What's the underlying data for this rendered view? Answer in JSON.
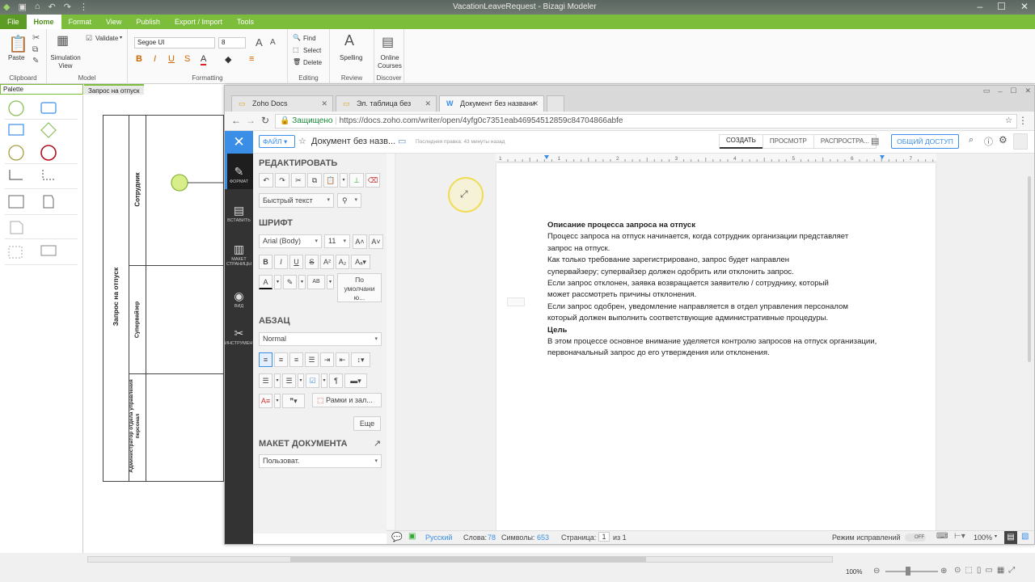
{
  "app": {
    "title": "VacationLeaveRequest - Bizagi Modeler",
    "tabs": [
      "File",
      "Home",
      "Format",
      "View",
      "Publish",
      "Export / Import",
      "Tools"
    ],
    "ribbon": {
      "clipboard": {
        "paste": "Paste",
        "label": "Clipboard"
      },
      "model": {
        "sim_line1": "Simulation",
        "sim_line2": "View",
        "validate": "Validate",
        "label": "Model"
      },
      "formatting": {
        "font": "Segoe UI",
        "size": "8",
        "label": "Formatting"
      },
      "editing": {
        "find": "Find",
        "select": "Select",
        "delete": "Delete",
        "label": "Editing"
      },
      "review": {
        "spelling": "Spelling",
        "label": "Review"
      },
      "discover": {
        "line1": "Online",
        "line2": "Courses",
        "label": "Discover"
      }
    },
    "palette_label": "Palette",
    "diagram_tab": "Запрос на отпуск",
    "pool_label": "Запрос на отпуск",
    "lanes": [
      "Сотрудник",
      "Супервайзер",
      "Администратор отдела управления персонал"
    ],
    "zoom": "100%"
  },
  "browser": {
    "tabs": [
      {
        "label": "Zoho Docs",
        "icon": "folder-icon"
      },
      {
        "label": "Эл. таблица без назван",
        "icon": "folder-icon"
      },
      {
        "label": "Документ без названи",
        "icon": "zoho-writer-icon"
      }
    ],
    "secure_label": "Защищено",
    "url": "https://docs.zoho.com/writer/open/4yfg0c7351eab46954512859c84704866abfe"
  },
  "writer": {
    "file_button": "ФАЙЛ",
    "doc_title": "Документ без назв...",
    "last_edit": "Последняя правка: 43 минуты назад",
    "modes": [
      "СОЗДАТЬ",
      "ПРОСМОТР",
      "РАСПРОСТРА..."
    ],
    "share_button": "ОБЩИЙ ДОСТУП",
    "rail": [
      {
        "icon": "pen-icon",
        "label": "ФОРМАТ"
      },
      {
        "icon": "insert-icon",
        "label": "ВСТАВИТЬ"
      },
      {
        "icon": "page-layout-icon",
        "label": "МАКЕТ СТРАНИЦЫ"
      },
      {
        "icon": "eye-icon",
        "label": "ВИД"
      },
      {
        "icon": "tools-icon",
        "label": "ИНСТРУМЕНТЫ"
      }
    ],
    "panel": {
      "edit_heading": "РЕДАКТИРОВАТЬ",
      "quick_text": "Быстрый текст",
      "font_heading": "ШРИФТ",
      "font_name": "Arial (Body)",
      "font_size": "11",
      "default_line1": "По",
      "default_line2": "умолчани",
      "default_line3": "ю...",
      "para_heading": "АБЗАЦ",
      "para_style": "Normal",
      "borders": "Рамки и зал...",
      "more": "Еще",
      "layout_heading": "МАКЕТ ДОКУМЕНТА",
      "layout_value": "Пользоват."
    },
    "document": {
      "heading": "Описание процесса запроса на отпуск",
      "lines": [
        "Процесс запроса на отпуск начинается, когда сотрудник организации представляет",
        "запрос на отпуск.",
        "Как только требование зарегистрировано, запрос будет направлен",
        "супервайзеру; супервайзер должен одобрить или отклонить запрос.",
        "Если запрос отклонен, заявка возвращается заявителю / сотруднику, который",
        "может рассмотреть причины отклонения.",
        "Если запрос одобрен, уведомление направляется в отдел управления персоналом",
        "который должен выполнить соответствующие административные процедуры."
      ],
      "heading2": "Цель",
      "lines2": [
        "В этом процессе основное внимание уделяется контролю запросов на отпуск организации,",
        "первоначальный запрос до его утверждения или отклонения."
      ]
    },
    "status": {
      "language": "Русский",
      "words_label": "Слова:",
      "words": "78",
      "chars_label": "Символы:",
      "chars": "653",
      "page_label": "Страница:",
      "page": "1",
      "of": "из 1",
      "track_label": "Режим исправлений",
      "track_state": "OFF",
      "zoom": "100%"
    },
    "ruler_numbers": [
      "1",
      "1",
      "2",
      "3",
      "4",
      "5",
      "6",
      "7"
    ]
  },
  "colors": {
    "ribbon_green": "#7cbd3c",
    "zoho_blue": "#3b8ee6",
    "rail_dark": "#333333"
  }
}
